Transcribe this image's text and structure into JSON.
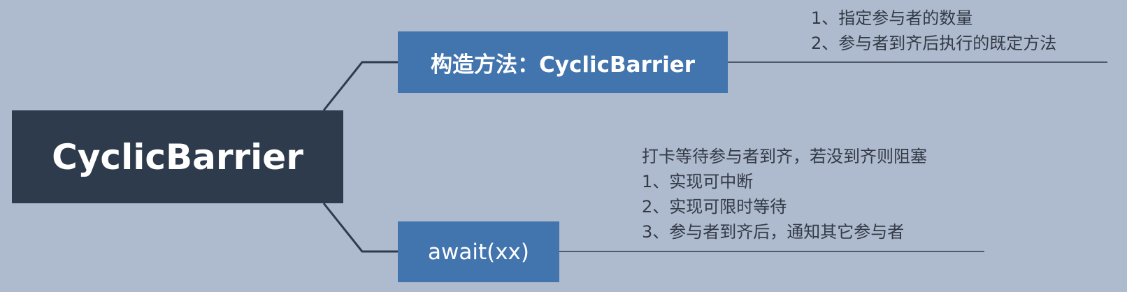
{
  "root": {
    "label": "CyclicBarrier"
  },
  "branches": [
    {
      "label": "构造方法：CyclicBarrier",
      "notes": [
        "1、指定参与者的数量",
        "2、参与者到齐后执行的既定方法"
      ]
    },
    {
      "label": "await(xx)",
      "notes": [
        "打卡等待参与者到齐，若没到齐则阻塞",
        "1、实现可中断",
        "2、实现可限时等待",
        "3、参与者到齐后，通知其它参与者"
      ]
    }
  ],
  "colors": {
    "background": "#aebbcf",
    "root_fill": "#2e3b4c",
    "branch_fill": "#4274ae",
    "connector": "#2e3b4c",
    "note_text": "#333a45"
  }
}
